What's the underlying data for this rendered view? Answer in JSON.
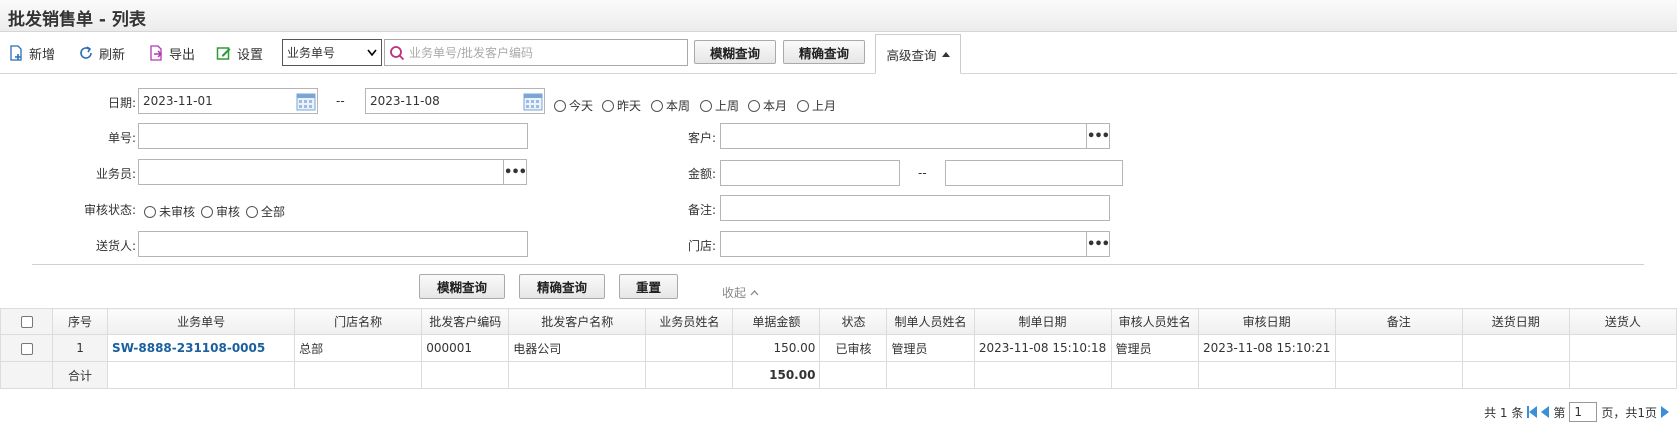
{
  "page": {
    "title": "批发销售单 - 列表"
  },
  "toolbar": {
    "add": "新增",
    "refresh": "刷新",
    "export": "导出",
    "settings": "设置",
    "field_select": "业务单号",
    "search_placeholder": "业务单号/批发客户编码",
    "fuzzy_query": "模糊查询",
    "exact_query": "精确查询",
    "advanced_query": "高级查询"
  },
  "filters": {
    "date_label": "日期:",
    "date_from": "2023-11-01",
    "date_sep": "--",
    "date_to": "2023-11-08",
    "quick_dates": [
      "今天",
      "昨天",
      "本周",
      "上周",
      "本月",
      "上月"
    ],
    "order_no_label": "单号:",
    "customer_label": "客户:",
    "salesperson_label": "业务员:",
    "amount_label": "金额:",
    "amount_sep": "--",
    "audit_status_label": "审核状态:",
    "audit_options": [
      "未审核",
      "审核",
      "全部"
    ],
    "remark_label": "备注:",
    "deliverer_label": "送货人:",
    "store_label": "门店:",
    "ellipsis": "•••"
  },
  "actions": {
    "fuzzy_query": "模糊查询",
    "exact_query": "精确查询",
    "reset": "重置",
    "collapse": "收起"
  },
  "grid": {
    "columns": [
      "序号",
      "业务单号",
      "门店名称",
      "批发客户编码",
      "批发客户名称",
      "业务员姓名",
      "单据金额",
      "状态",
      "制单人员姓名",
      "制单日期",
      "审核人员姓名",
      "审核日期",
      "备注",
      "送货日期",
      "送货人"
    ],
    "rows": [
      {
        "seq": "1",
        "order_no": "SW-8888-231108-0005",
        "store": "总部",
        "customer_code": "000001",
        "customer_name": "电器公司",
        "salesperson": "",
        "amount": "150.00",
        "status": "已审核",
        "creator": "管理员",
        "create_date": "2023-11-08 15:10:18",
        "auditor": "管理员",
        "audit_date": "2023-11-08 15:10:21",
        "remark": "",
        "delivery_date": "",
        "deliverer": ""
      }
    ],
    "total": {
      "label": "合计",
      "amount": "150.00"
    }
  },
  "pager": {
    "total_text": "共 1 条",
    "page_prefix": "第",
    "page_value": "1",
    "page_suffix": "页，共1页"
  },
  "colors": {
    "link": "#1a5f9e",
    "accent_blue": "#3b8fd9"
  }
}
